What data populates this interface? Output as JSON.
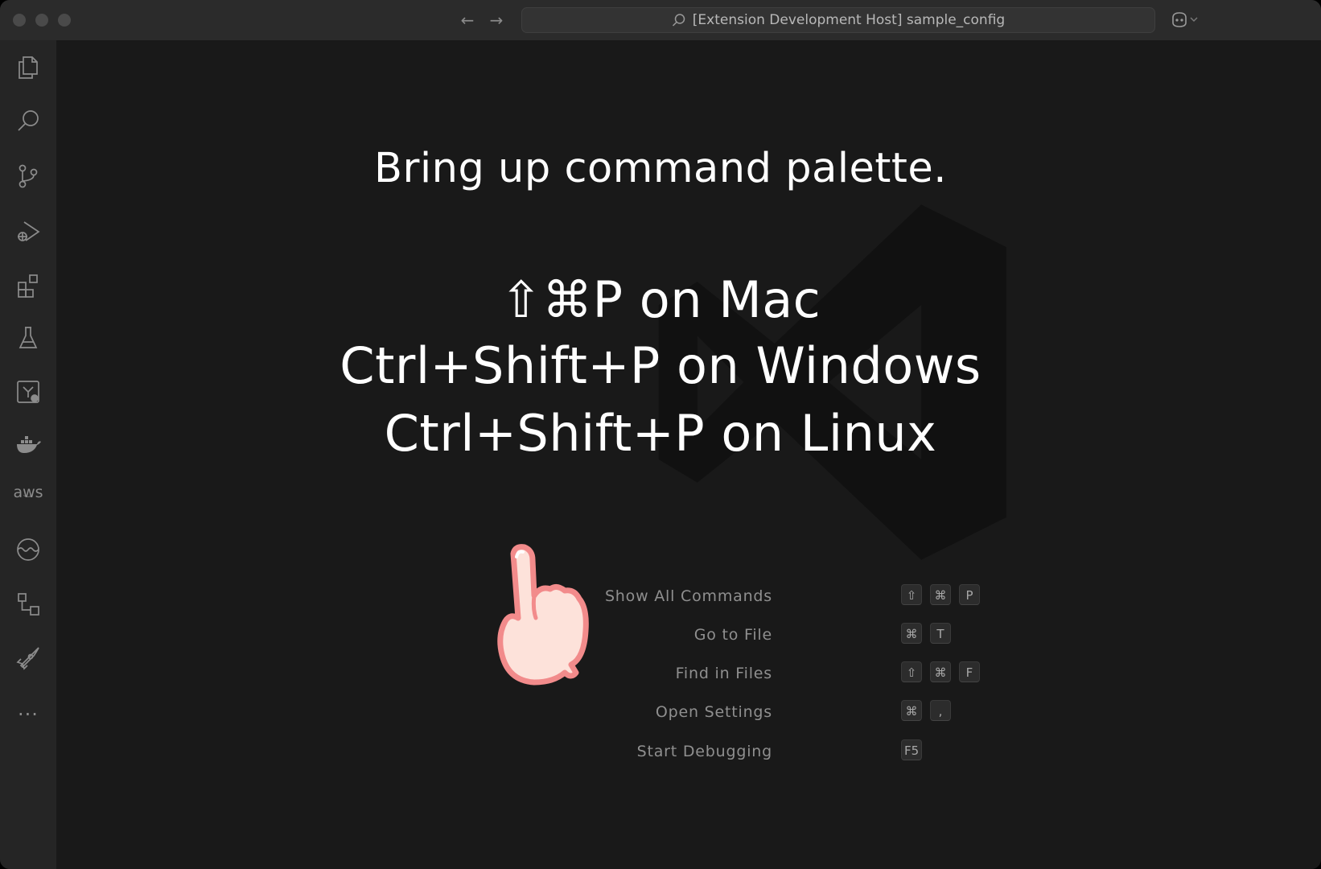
{
  "window": {
    "title": "[Extension Development Host] sample_config"
  },
  "nav": {
    "back": "←",
    "forward": "→"
  },
  "activity_bar": {
    "items": [
      {
        "name": "explorer-icon"
      },
      {
        "name": "search-icon"
      },
      {
        "name": "source-control-icon"
      },
      {
        "name": "run-debug-icon"
      },
      {
        "name": "extensions-icon"
      },
      {
        "name": "testing-icon"
      },
      {
        "name": "remote-explorer-icon"
      },
      {
        "name": "docker-icon"
      },
      {
        "name": "aws-icon",
        "text": "aws"
      },
      {
        "name": "wave-icon"
      },
      {
        "name": "hierarchy-icon"
      },
      {
        "name": "rocket-icon"
      },
      {
        "name": "more-icon",
        "text": "···"
      }
    ]
  },
  "tip": {
    "title": "Bring up command palette.",
    "lines": [
      "⇧⌘P on Mac",
      "Ctrl+Shift+P on Windows",
      "Ctrl+Shift+P on Linux"
    ]
  },
  "shortcuts": [
    {
      "label": "Show All Commands",
      "keys": [
        "⇧",
        "⌘",
        "P"
      ]
    },
    {
      "label": "Go to File",
      "keys": [
        "⌘",
        "T"
      ]
    },
    {
      "label": "Find in Files",
      "keys": [
        "⇧",
        "⌘",
        "F"
      ]
    },
    {
      "label": "Open Settings",
      "keys": [
        "⌘",
        ","
      ]
    },
    {
      "label": "Start Debugging",
      "keys": [
        "F5"
      ]
    }
  ],
  "colors": {
    "editor_bg": "#191919",
    "activity_bg": "#252525",
    "titlebar_bg": "#2b2b2b",
    "hand_fill": "#fde2da",
    "hand_stroke": "#f28b8b"
  }
}
